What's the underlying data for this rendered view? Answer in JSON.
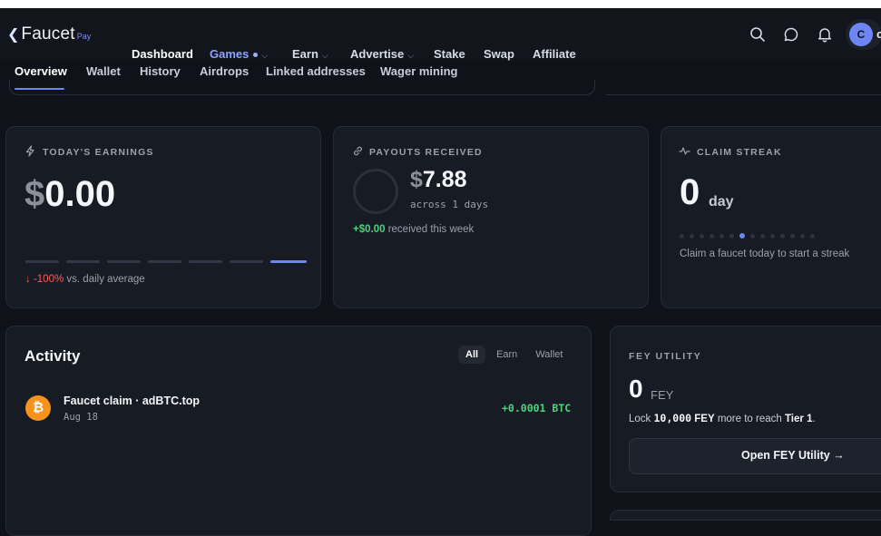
{
  "header": {
    "logo": {
      "text": "Faucet",
      "sub": "Pay"
    },
    "nav": [
      {
        "label": "Dashboard"
      },
      {
        "label": "Games"
      },
      {
        "label": "Earn"
      },
      {
        "label": "Advertise"
      },
      {
        "label": "Stake"
      },
      {
        "label": "Swap"
      },
      {
        "label": "Affiliate"
      }
    ],
    "avatar": {
      "initial": "C",
      "tail": "c"
    },
    "icons": [
      "search-icon",
      "chat-icon",
      "bell-icon"
    ]
  },
  "subnav": {
    "tabs": [
      {
        "label": "Overview"
      },
      {
        "label": "Wallet"
      },
      {
        "label": "History"
      },
      {
        "label": "Airdrops"
      },
      {
        "label": "Linked addresses"
      },
      {
        "label": "Wager mining"
      }
    ]
  },
  "earnings": {
    "label": "TODAY'S EARNINGS",
    "currency": "$",
    "value": "0.00",
    "delta": "-100%",
    "delta_suffix": "vs. daily average",
    "bar_count": 7,
    "active_bar": 7
  },
  "payouts": {
    "label": "PAYOUTS RECEIVED",
    "currency": "$",
    "value": "7.88",
    "sub": "across 1 days",
    "week_amount": "+$0.00",
    "week_suffix": "received this week"
  },
  "streak": {
    "label": "CLAIM STREAK",
    "value": "0",
    "unit": "day",
    "dot_count": 14,
    "active_dot": 7,
    "hint": "Claim a faucet today to start a streak"
  },
  "activity": {
    "title": "Activity",
    "filters": [
      {
        "label": "All"
      },
      {
        "label": "Earn"
      },
      {
        "label": "Wallet"
      }
    ],
    "items": [
      {
        "title": "Faucet claim · adBTC.top",
        "date": "Aug 18",
        "amount": "+0.0001 BTC",
        "icon": "bitcoin-icon"
      }
    ]
  },
  "fey": {
    "label": "FEY UTILITY",
    "value": "0",
    "unit": "FEY",
    "lock_prefix": "Lock",
    "lock_amount": "10,000",
    "lock_unit": "FEY",
    "lock_mid": "more to reach",
    "lock_tier": "Tier 1",
    "lock_end": ".",
    "button_label": "Open FEY Utility"
  },
  "colors": {
    "accent": "#6d86f5",
    "positive": "#4cd37b",
    "negative": "#ff5d5d",
    "bitcoin": "#f7931a"
  }
}
